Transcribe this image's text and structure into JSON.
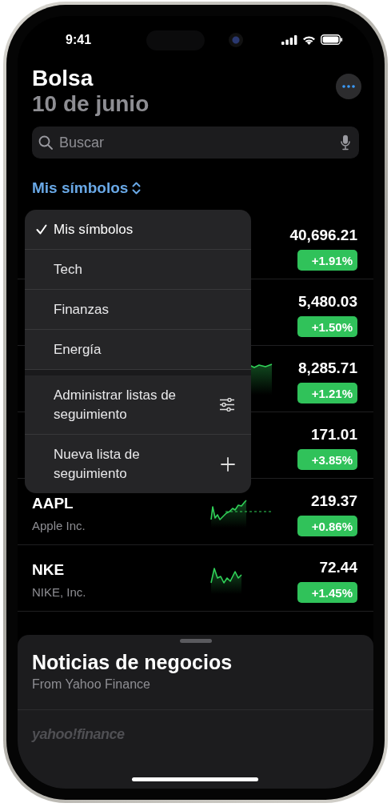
{
  "status_bar": {
    "time": "9:41"
  },
  "header": {
    "title": "Bolsa",
    "date": "10 de junio"
  },
  "search": {
    "placeholder": "Buscar"
  },
  "watchlist_picker": {
    "label": "Mis símbolos"
  },
  "stocks": [
    {
      "price": "40,696.21",
      "change": "+1.91%",
      "sparkline": false
    },
    {
      "price": "5,480.03",
      "change": "+1.50%",
      "sparkline": false
    },
    {
      "price": "8,285.71",
      "change": "+1.21%",
      "sparkline": true
    },
    {
      "price": "171.01",
      "change": "+3.85%",
      "sparkline": false
    },
    {
      "symbol": "AAPL",
      "name": "Apple Inc.",
      "price": "219.37",
      "change": "+0.86%",
      "sparkline": true
    },
    {
      "symbol": "NKE",
      "name": "NIKE, Inc.",
      "price": "72.44",
      "change": "+1.45%",
      "sparkline": true
    }
  ],
  "menu": {
    "lists": [
      {
        "label": "Mis símbolos",
        "selected": true
      },
      {
        "label": "Tech",
        "selected": false
      },
      {
        "label": "Finanzas",
        "selected": false
      },
      {
        "label": "Energía",
        "selected": false
      }
    ],
    "actions": [
      {
        "label": "Administrar listas de seguimiento"
      },
      {
        "label": "Nueva lista de seguimiento"
      }
    ]
  },
  "news_sheet": {
    "title": "Noticias de negocios",
    "subtitle": "From Yahoo Finance",
    "logo": "yahoo!finance"
  }
}
